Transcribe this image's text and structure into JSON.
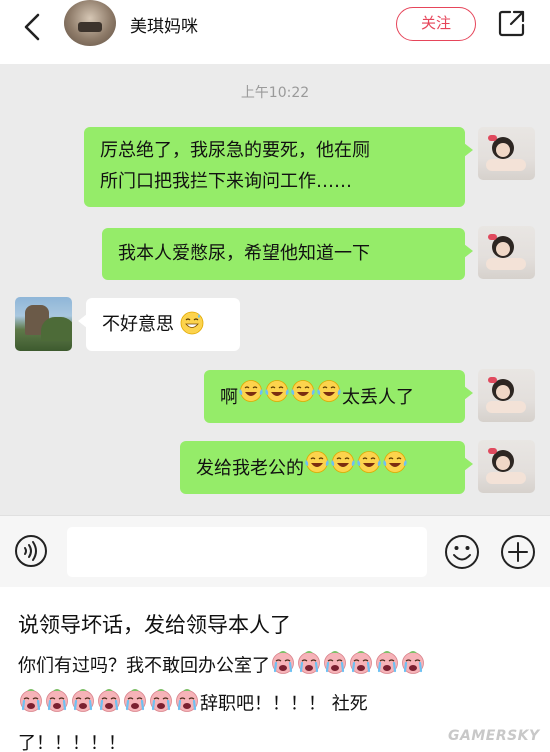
{
  "header": {
    "username": "美琪妈咪",
    "follow_label": "关注",
    "icons": [
      "back-icon",
      "share-icon"
    ]
  },
  "chat": {
    "timestamp": "上午10:22",
    "messages": [
      {
        "from": "me",
        "line1": "厉总绝了，我尿急的要死，他在厕",
        "line2": "所门口把我拦下来询问工作……"
      },
      {
        "from": "me",
        "text": "我本人爱憋尿，希望他知道一下"
      },
      {
        "from": "them",
        "text": "不好意思",
        "emoji": "sweat-smile-emoji"
      },
      {
        "from": "me",
        "prefix": "啊",
        "suffix": "太丢人了",
        "emoji": "crying-laughing-emoji",
        "emoji_count": 4
      },
      {
        "from": "me",
        "prefix": "发给我老公的",
        "emoji": "crying-laughing-emoji",
        "emoji_count": 4
      }
    ]
  },
  "input_bar": {
    "icons": [
      "voice-icon",
      "smile-icon",
      "plus-icon"
    ]
  },
  "caption": {
    "line1": "说领导坏话，发给领导本人了",
    "line2": "你们有过吗？我不敢回办公室了",
    "line3_suffix": "辞职吧！！！！ 社死",
    "line4": "了！！！！！",
    "emoji": "crying-face-emoji",
    "line2_emoji_count": 6,
    "line3_emoji_count": 7
  },
  "watermark": "GAMERSKY",
  "colors": {
    "my_bubble": "#95ec69",
    "their_bubble": "#ffffff",
    "chat_background": "#ebebeb",
    "follow_accent": "#e6455a"
  }
}
